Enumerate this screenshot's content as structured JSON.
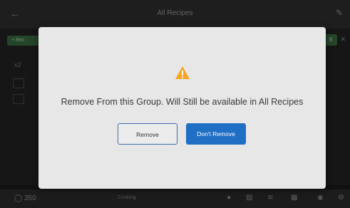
{
  "header": {
    "title": "All Recipes",
    "back_icon": "arrow-left-icon",
    "edit_icon": "pencil-icon"
  },
  "background": {
    "add_chip_label": "+ Rec",
    "side_label": "x2",
    "right_chip_label": "8"
  },
  "footer": {
    "temperature": "350",
    "status_text": "Cooking"
  },
  "dialog": {
    "icon": "warning-icon",
    "icon_color": "#f5a623",
    "message": "Remove From this Group. Will Still be available in All Recipes",
    "remove_label": "Remove",
    "dont_remove_label": "Don't Remove",
    "accent_color": "#1f6fc4"
  }
}
